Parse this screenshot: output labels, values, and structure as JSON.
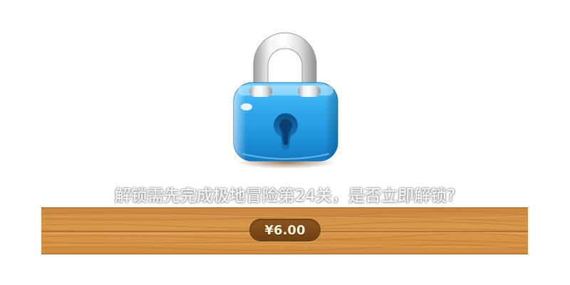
{
  "lock": {
    "icon": "padlock-icon",
    "body_color": "#2aa2e6",
    "shackle_color": "#e2e2e2"
  },
  "prompt": {
    "text": "解锁需先完成极地冒险第24关，是否立即解锁?"
  },
  "unlock": {
    "price_label": "¥6.00"
  },
  "colors": {
    "wood": "#d4934a",
    "pill": "#7a4518",
    "text_shadow": "#a8a8a8"
  }
}
